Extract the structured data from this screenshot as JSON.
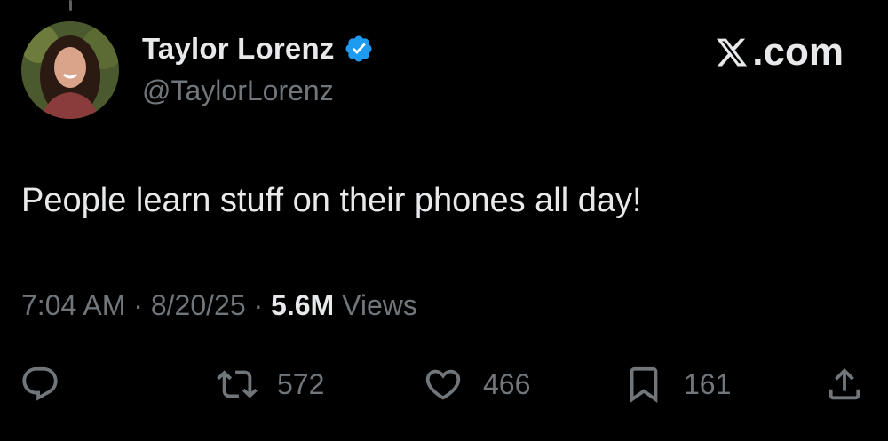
{
  "author": {
    "display_name": "Taylor Lorenz",
    "handle": "@TaylorLorenz",
    "verified_icon": "verified-badge-icon"
  },
  "brand": {
    "text": ".com",
    "logo_icon": "x-logo-icon"
  },
  "tweet": {
    "text": "People learn stuff on their phones all day!",
    "time": "7:04 AM",
    "date": "8/20/25",
    "views_count": "5.6M",
    "views_label": "Views",
    "separator": "·"
  },
  "actions": {
    "reply_icon": "reply-icon",
    "retweet_count": "572",
    "like_count": "466",
    "bookmark_count": "161",
    "share_icon": "share-icon"
  },
  "colors": {
    "background": "#000000",
    "text_primary": "#e7e9ea",
    "text_secondary": "#71767b",
    "verified_blue": "#1d9bf0"
  }
}
